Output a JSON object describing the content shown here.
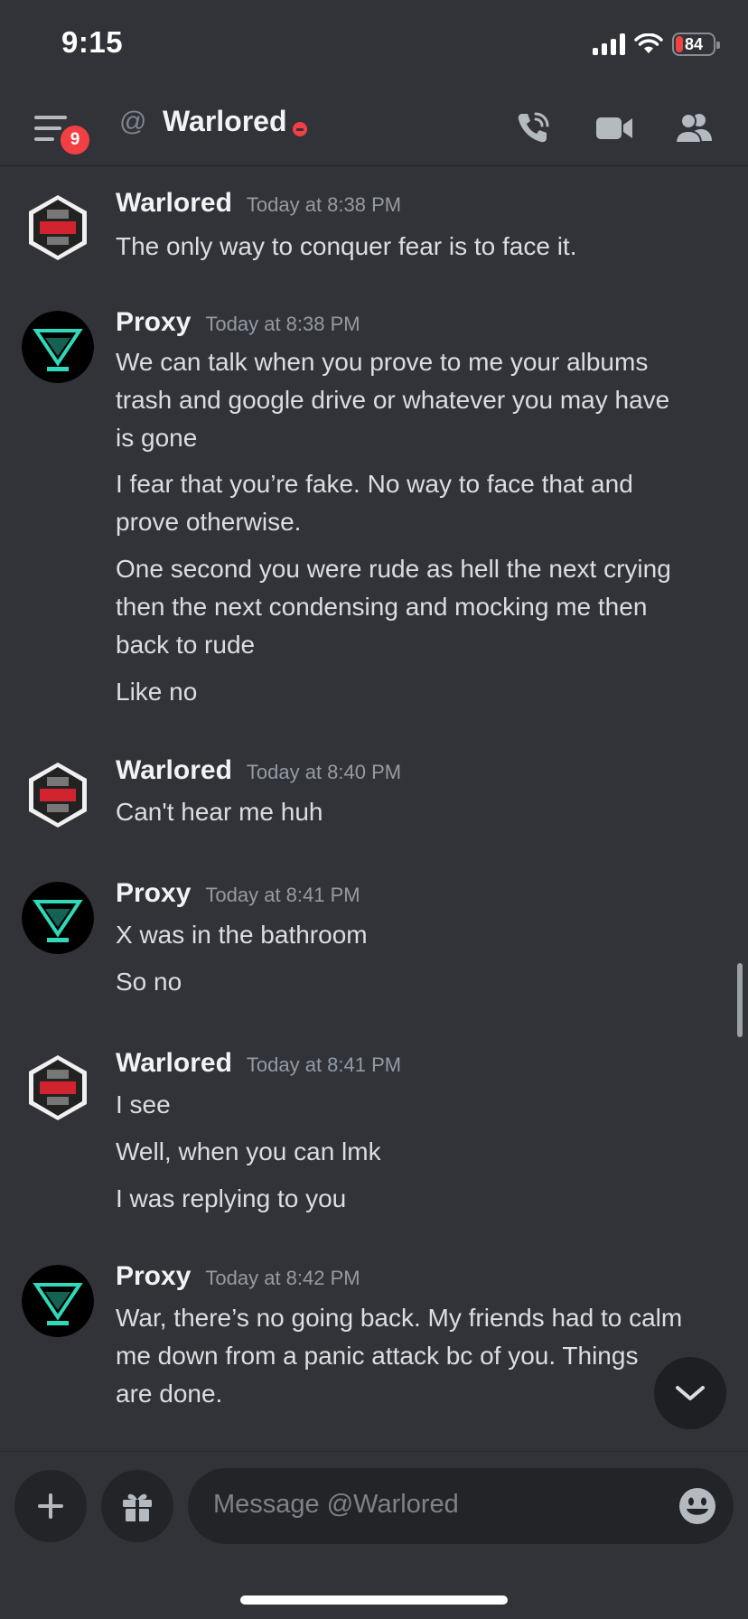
{
  "status_bar": {
    "time": "9:15",
    "battery": "84"
  },
  "header": {
    "badge_count": "9",
    "channel_name": "Warlored"
  },
  "messages": [
    {
      "author": "Warlored",
      "timestamp": "Today at 8:38 PM",
      "lines": [
        "The only way to conquer fear is to face it."
      ]
    },
    {
      "author": "Proxy",
      "timestamp": "Today at 8:38 PM",
      "lines": [
        "We can talk when you prove to me your albums",
        "trash and google drive or whatever you may have",
        "is gone",
        "I fear that you’re fake. No way to face that and",
        "prove otherwise.",
        "One second you were rude as hell the next crying",
        "then the next condensing and mocking me then",
        "back to rude",
        "Like no"
      ]
    },
    {
      "author": "Warlored",
      "timestamp": "Today at 8:40 PM",
      "lines": [
        "Can't hear me huh"
      ]
    },
    {
      "author": "Proxy",
      "timestamp": "Today at 8:41 PM",
      "lines": [
        "X was in the bathroom",
        "So no"
      ]
    },
    {
      "author": "Warlored",
      "timestamp": "Today at 8:41 PM",
      "lines": [
        "I see",
        "Well, when you can lmk",
        "I was replying to you"
      ]
    },
    {
      "author": "Proxy",
      "timestamp": "Today at 8:42 PM",
      "lines": [
        "War, there’s no going back. My friends had to calm",
        "me down from a panic attack bc of you. Things",
        "are done."
      ]
    }
  ],
  "composer": {
    "placeholder": "Message @Warlored"
  },
  "icons": {
    "menu": "menu-icon",
    "call": "phone-call-icon",
    "video": "video-icon",
    "members": "members-icon",
    "add": "plus-icon",
    "gift": "gift-icon",
    "emoji": "emoji-icon",
    "jump": "chevron-down-icon"
  },
  "colors": {
    "background": "#313338",
    "dnd_status": "#f23f43",
    "badge": "#f23f43",
    "proxy_accent": "#2fd9b9",
    "warlored_accent": "#d1242f"
  }
}
